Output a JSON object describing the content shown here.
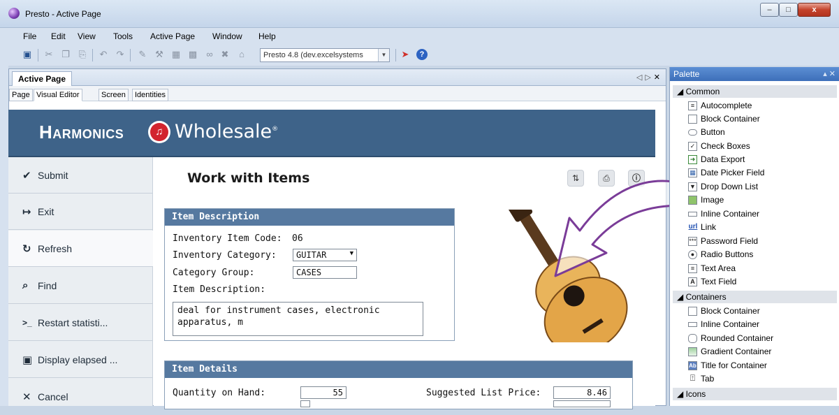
{
  "window": {
    "title": "Presto - Active Page"
  },
  "menu": [
    "File",
    "Edit",
    "View",
    "Tools",
    "Active Page",
    "Window",
    "Help"
  ],
  "toolbar": {
    "environment": "Presto 4.8 (dev.excelsystems"
  },
  "doc_tab": {
    "label": "Active Page"
  },
  "view_tabs": [
    "Page",
    "Visual Editor",
    "Screen",
    "Identities"
  ],
  "brand": {
    "harmonics": "Harmonics",
    "mark": "♫",
    "wholesale": "Wholesale",
    "reg": "®"
  },
  "nav": [
    {
      "label": "Submit",
      "icon": "check-icon",
      "glyph": "✔"
    },
    {
      "label": "Exit",
      "icon": "exit-icon",
      "glyph": "↦"
    },
    {
      "label": "Refresh",
      "icon": "refresh-icon",
      "glyph": "↻"
    },
    {
      "label": "Find",
      "icon": "search-icon",
      "glyph": "⌕"
    },
    {
      "label": "Restart statisti...",
      "icon": "terminal-icon",
      "glyph": ">_"
    },
    {
      "label": "Display elapsed ...",
      "icon": "window-icon",
      "glyph": "▣"
    },
    {
      "label": "Cancel",
      "icon": "close-icon",
      "glyph": "✕"
    }
  ],
  "page": {
    "title": "Work with Items"
  },
  "item_description": {
    "heading": "Item Description",
    "code_label": "Inventory Item Code:",
    "code_value": "06",
    "category_label": "Inventory Category:",
    "category_value": "GUITAR",
    "group_label": "Category Group:",
    "group_value": "CASES",
    "desc_label": "Item Description:",
    "desc_line1": "deal for instrument cases, electronic",
    "desc_line2": "apparatus, m"
  },
  "item_details": {
    "heading": "Item Details",
    "qty_label": "Quantity on Hand:",
    "qty_value": "55",
    "price_label": "Suggested List Price:",
    "price_value": "8.46"
  },
  "palette": {
    "title": "Palette",
    "groups": [
      {
        "label": "Common",
        "items": [
          "Autocomplete",
          "Block Container",
          "Button",
          "Check Boxes",
          "Data Export",
          "Date Picker Field",
          "Drop Down List",
          "Image",
          "Inline Container",
          "Link",
          "Password Field",
          "Radio Buttons",
          "Text Area",
          "Text Field"
        ]
      },
      {
        "label": "Containers",
        "items": [
          "Block Container",
          "Inline Container",
          "Rounded Container",
          "Gradient Container",
          "Title for Container",
          "Tab"
        ]
      },
      {
        "label": "Icons",
        "items": []
      }
    ]
  },
  "colors": {
    "header": "#3e6389",
    "panel_head": "#5679a0",
    "arrow": "#7a3c98"
  }
}
